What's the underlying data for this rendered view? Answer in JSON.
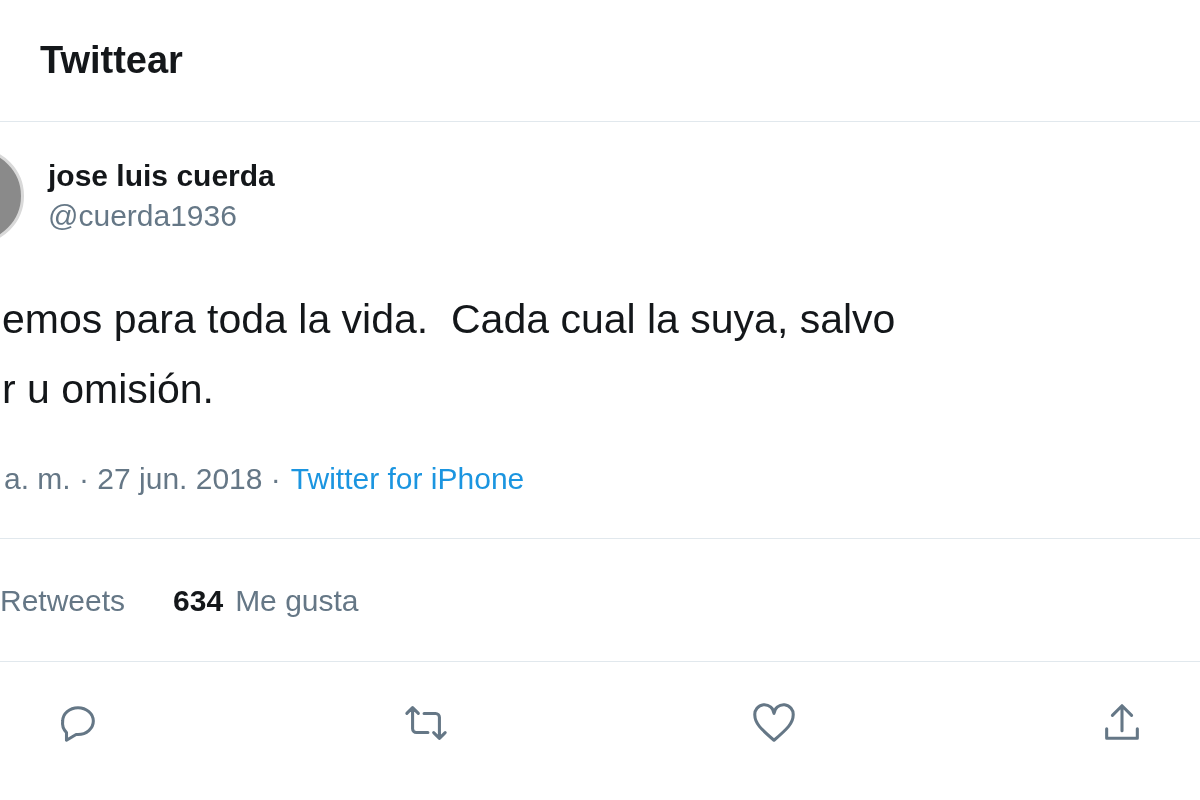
{
  "header": {
    "title": "Twittear"
  },
  "author": {
    "name": "jose luis cuerda",
    "handle": "@cuerda1936"
  },
  "tweet": {
    "lines": [
      "emos para toda la vida.  Cada cual la suya, salvo",
      "r u omisión."
    ]
  },
  "meta": {
    "time": "a. m. · 27 jun. 2018 ·",
    "source": "Twitter for iPhone"
  },
  "stats": [
    {
      "label": "Retweets"
    },
    {
      "count": "634",
      "label": "Me gusta"
    }
  ],
  "actions": [
    {
      "kind": "reply"
    },
    {
      "kind": "retweet"
    },
    {
      "kind": "like"
    },
    {
      "kind": "share"
    }
  ]
}
